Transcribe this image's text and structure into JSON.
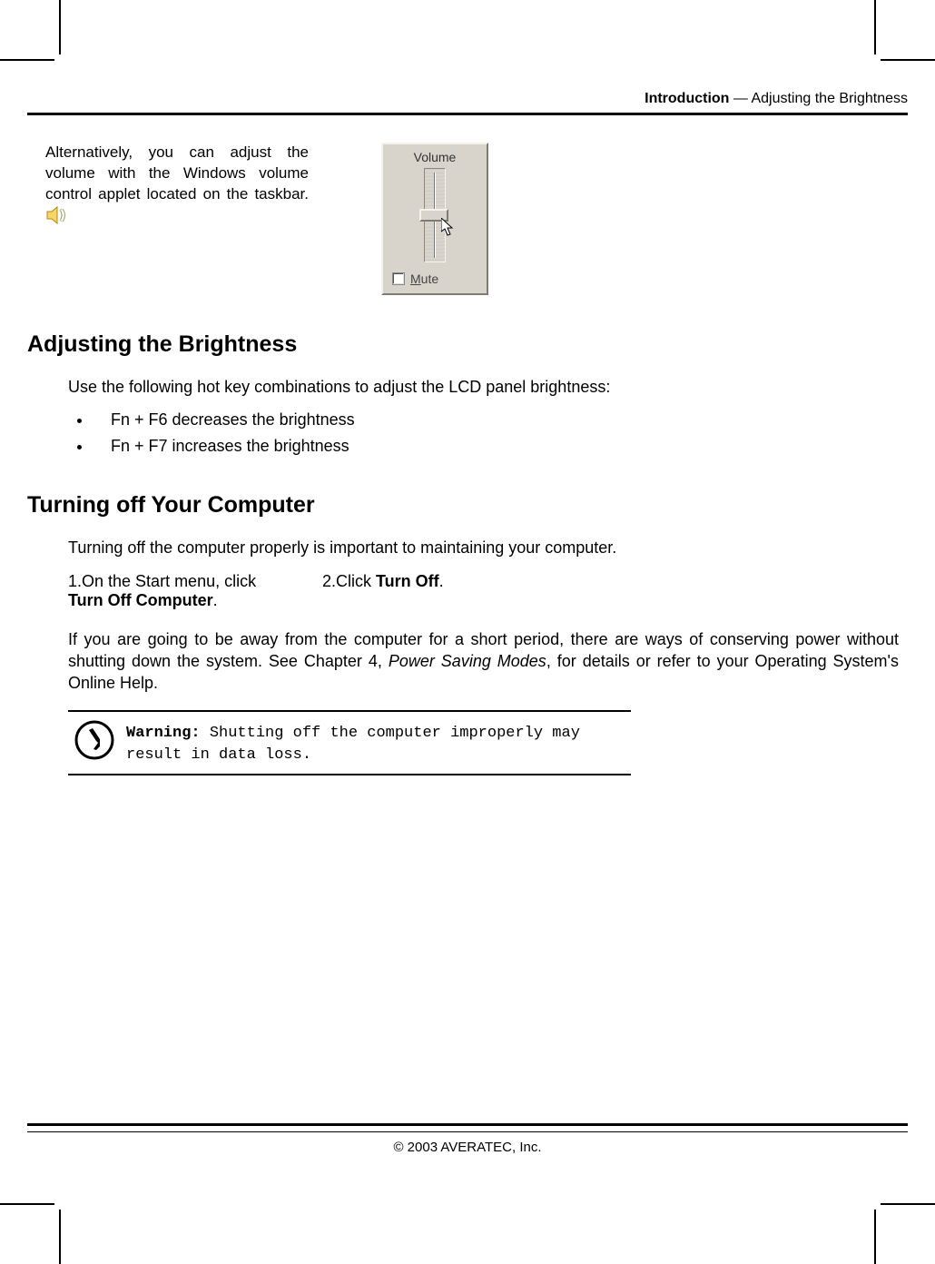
{
  "header": {
    "section_bold": "Introduction",
    "section_sep": " — ",
    "section_plain": "Adjusting the Brightness"
  },
  "intro": {
    "text_before_icon": "Alternatively, you can adjust the volume with the Windows volume control applet located on the taskbar. "
  },
  "volume_widget": {
    "title": "Volume",
    "mute_prefix": "M",
    "mute_rest": "ute"
  },
  "brightness": {
    "heading": "Adjusting the Brightness",
    "intro": "Use the following hot key combinations to adjust the LCD panel brightness:",
    "bullets": [
      "Fn + F6 decreases the brightness",
      "Fn + F7 increases the brightness"
    ]
  },
  "turnoff": {
    "heading": "Turning off Your Computer",
    "intro": "Turning off the computer properly is important to maintaining your computer.",
    "step1_num": "1.",
    "step1_a": "On the Start menu, click ",
    "step1_bold": "Turn Off Computer",
    "step1_b": ".",
    "step2_num": "2.",
    "step2_a": "Click ",
    "step2_bold": "Turn Off",
    "step2_b": ".",
    "para_a": "If you are going to be away from the computer for a short period, there are ways of conserving power without shutting down the system. See Chapter 4, ",
    "para_italic": "Power Saving Modes",
    "para_b": ", for details or refer to your Operating System's Online Help."
  },
  "warning": {
    "label": "Warning:",
    "text": " Shutting off the computer improperly may result in data loss."
  },
  "footer": {
    "copyright": "© 2003 AVERATEC, Inc."
  }
}
